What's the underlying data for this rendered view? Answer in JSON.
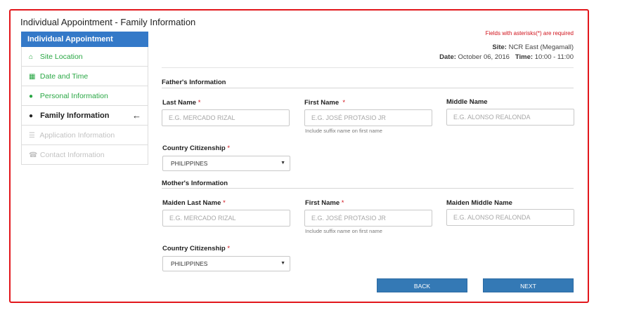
{
  "page_title": "Individual Appointment - Family Information",
  "sidebar": {
    "header": "Individual Appointment",
    "items": [
      {
        "label": "Site Location",
        "state": "done",
        "icon": "home-icon",
        "glyph": "⌂"
      },
      {
        "label": "Date and Time",
        "state": "done",
        "icon": "calendar-icon",
        "glyph": "▦"
      },
      {
        "label": "Personal Information",
        "state": "done",
        "icon": "user-icon",
        "glyph": "●"
      },
      {
        "label": "Family Information",
        "state": "active",
        "icon": "users-icon",
        "glyph": "●"
      },
      {
        "label": "Application Information",
        "state": "disabled",
        "icon": "list-icon",
        "glyph": "☰"
      },
      {
        "label": "Contact Information",
        "state": "disabled",
        "icon": "phone-icon",
        "glyph": "☎"
      }
    ],
    "active_arrow": "←"
  },
  "required_note": "Fields with asterisks(*) are required",
  "info": {
    "site_label": "Site:",
    "site_value": "NCR East (Megamall)",
    "date_label": "Date:",
    "date_value": "October 06, 2016",
    "time_label": "Time:",
    "time_value": "10:00 - 11:00"
  },
  "father": {
    "title": "Father's Information",
    "last_name_label": "Last Name",
    "last_name_placeholder": "E.G. MERCADO RIZAL",
    "first_name_label": "First Name",
    "first_name_placeholder": "E.G. JOSÉ PROTASIO JR",
    "first_name_hint": "Include suffix name on first name",
    "middle_name_label": "Middle Name",
    "middle_name_placeholder": "E.G. ALONSO REALONDA",
    "citizenship_label": "Country Citizenship",
    "citizenship_value": "PHILIPPINES"
  },
  "mother": {
    "title": "Mother's Information",
    "maiden_last_label": "Maiden Last Name",
    "maiden_last_placeholder": "E.G. MERCADO RIZAL",
    "first_name_label": "First Name",
    "first_name_placeholder": "E.G. JOSÉ PROTASIO JR",
    "first_name_hint": "Include suffix name on first name",
    "maiden_middle_label": "Maiden Middle Name",
    "maiden_middle_placeholder": "E.G. ALONSO REALONDA",
    "citizenship_label": "Country Citizenship",
    "citizenship_value": "PHILIPPINES"
  },
  "required_mark": "*",
  "buttons": {
    "back": "BACK",
    "next": "NEXT"
  },
  "colors": {
    "accent": "#3479c8",
    "frame": "#e2161b",
    "done": "#29a744",
    "required": "#d0121b"
  }
}
